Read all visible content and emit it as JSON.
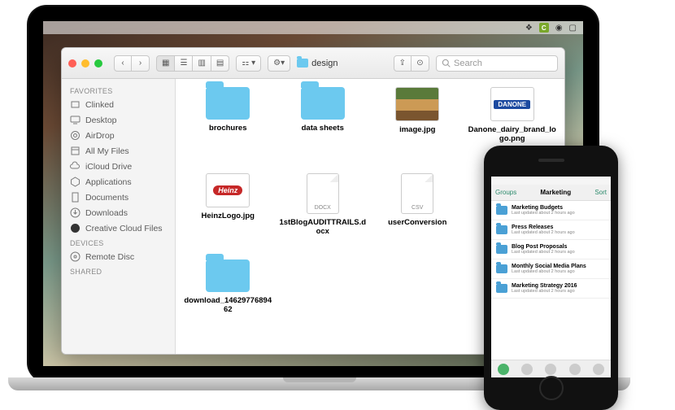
{
  "menubar": {
    "icons": [
      "leaf",
      "c",
      "cc",
      "airplay"
    ]
  },
  "finder": {
    "title": "design",
    "search_placeholder": "Search",
    "traffic": [
      "close",
      "minimize",
      "zoom"
    ],
    "nav": {
      "back": "‹",
      "fwd": "›"
    },
    "views": [
      "icon",
      "list",
      "column",
      "coverflow"
    ],
    "group_label": "⚙︎",
    "share_label": "⇪",
    "tags_label": "⊙"
  },
  "sidebar": {
    "sections": [
      {
        "title": "Favorites",
        "items": [
          {
            "icon": "clinked",
            "label": "Clinked"
          },
          {
            "icon": "desktop",
            "label": "Desktop"
          },
          {
            "icon": "airdrop",
            "label": "AirDrop"
          },
          {
            "icon": "allfiles",
            "label": "All My Files"
          },
          {
            "icon": "icloud",
            "label": "iCloud Drive"
          },
          {
            "icon": "apps",
            "label": "Applications"
          },
          {
            "icon": "docs",
            "label": "Documents"
          },
          {
            "icon": "downloads",
            "label": "Downloads"
          },
          {
            "icon": "cc",
            "label": "Creative Cloud Files"
          }
        ]
      },
      {
        "title": "Devices",
        "items": [
          {
            "icon": "disc",
            "label": "Remote Disc"
          }
        ]
      },
      {
        "title": "Shared",
        "items": []
      }
    ]
  },
  "items": [
    {
      "kind": "folder",
      "label": "brochures"
    },
    {
      "kind": "folder",
      "label": "data sheets"
    },
    {
      "kind": "image",
      "sub": "photo",
      "label": "image.jpg"
    },
    {
      "kind": "image",
      "sub": "danone",
      "badge": "DANONE",
      "label": "Danone_dairy_brand_logo.png"
    },
    {
      "kind": "image",
      "sub": "heinz",
      "badge": "Heinz",
      "label": "HeinzLogo.jpg"
    },
    {
      "kind": "doc",
      "ext": "DOCX",
      "label": "1stBlogAUDITTRAILS.docx"
    },
    {
      "kind": "doc",
      "ext": "CSV",
      "label": "userConversion"
    },
    {
      "kind": "spacer"
    },
    {
      "kind": "folder",
      "label": "download_1462977689462"
    }
  ],
  "phone": {
    "nav_left": "Groups",
    "title": "Marketing",
    "nav_right": "Sort",
    "rows": [
      {
        "title": "Marketing Budgets",
        "sub": "Last updated about 2 hours ago"
      },
      {
        "title": "Press Releases",
        "sub": "Last updated about 2 hours ago"
      },
      {
        "title": "Blog Post Proposals",
        "sub": "Last updated about 2 hours ago"
      },
      {
        "title": "Monthly Social Media Plans",
        "sub": "Last updated about 2 hours ago"
      },
      {
        "title": "Marketing Strategy 2016",
        "sub": "Last updated about 2 hours ago"
      }
    ]
  }
}
